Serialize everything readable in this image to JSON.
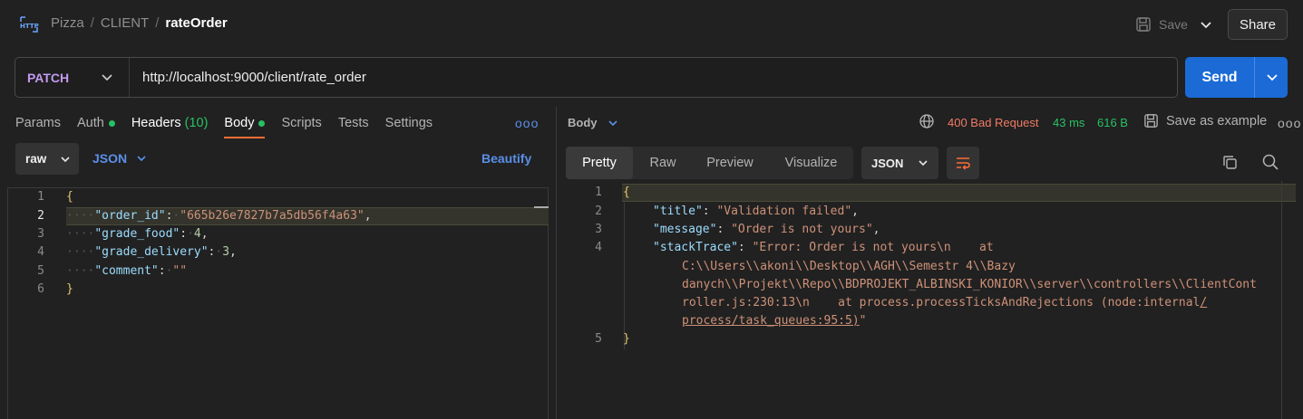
{
  "header": {
    "breadcrumb": [
      "Pizza",
      "CLIENT",
      "rateOrder"
    ],
    "save_label": "Save",
    "share_label": "Share"
  },
  "request": {
    "method": "PATCH",
    "url": "http://localhost:9000/client/rate_order",
    "send_label": "Send",
    "tabs": [
      {
        "label": "Params"
      },
      {
        "label": "Auth",
        "dot": true
      },
      {
        "label": "Headers",
        "count": "(10)"
      },
      {
        "label": "Body",
        "dot": true,
        "active": true
      },
      {
        "label": "Scripts"
      },
      {
        "label": "Tests"
      },
      {
        "label": "Settings"
      }
    ],
    "more_label": "ooo",
    "body_mode": "raw",
    "body_format": "JSON",
    "beautify_label": "Beautify",
    "line_numbers": [
      "1",
      "2",
      "3",
      "4",
      "5",
      "6"
    ],
    "body_lines": {
      "open": "{",
      "l2_key": "\"order_id\"",
      "l2_val": "\"665b26e7827b7a5db56f4a63\"",
      "l3_key": "\"grade_food\"",
      "l3_val": "4",
      "l4_key": "\"grade_delivery\"",
      "l4_val": "3",
      "l5_key": "\"comment\"",
      "l5_val": "\"\"",
      "close": "}"
    }
  },
  "response": {
    "section_label": "Body",
    "status": "400 Bad Request",
    "time": "43 ms",
    "size": "616 B",
    "save_example_label": "Save as example",
    "more_label": "ooo",
    "view_tabs": [
      "Pretty",
      "Raw",
      "Preview",
      "Visualize"
    ],
    "format": "JSON",
    "line_numbers": [
      "1",
      "2",
      "3",
      "4",
      "5"
    ],
    "lines": {
      "open": "{",
      "title_key": "\"title\"",
      "title_val": "\"Validation failed\"",
      "message_key": "\"message\"",
      "message_val": "\"Order is not yours\"",
      "stack_key": "\"stackTrace\"",
      "stack_val_1": "\"Error: Order is not yours\\n    at",
      "stack_val_2": "C:\\\\Users\\\\akoni\\\\Desktop\\\\AGH\\\\Semestr 4\\\\Bazy",
      "stack_val_3": "danych\\\\Projekt\\\\Repo\\\\BDPROJEKT_ALBINSKI_KONIOR\\\\server\\\\controllers\\\\ClientCont",
      "stack_val_4a": "roller.js:230:13\\n    at process.processTicksAndRejections (node:internal",
      "stack_val_4b": "/",
      "stack_val_5a": "process/task_queues:95:5)",
      "stack_val_5b": "\"",
      "close": "}"
    }
  },
  "colors": {
    "accent": "#ff6c37",
    "send": "#1b6ad6",
    "status_error": "#f07a64",
    "status_ok": "#27c165",
    "link": "#5a8fe8"
  }
}
